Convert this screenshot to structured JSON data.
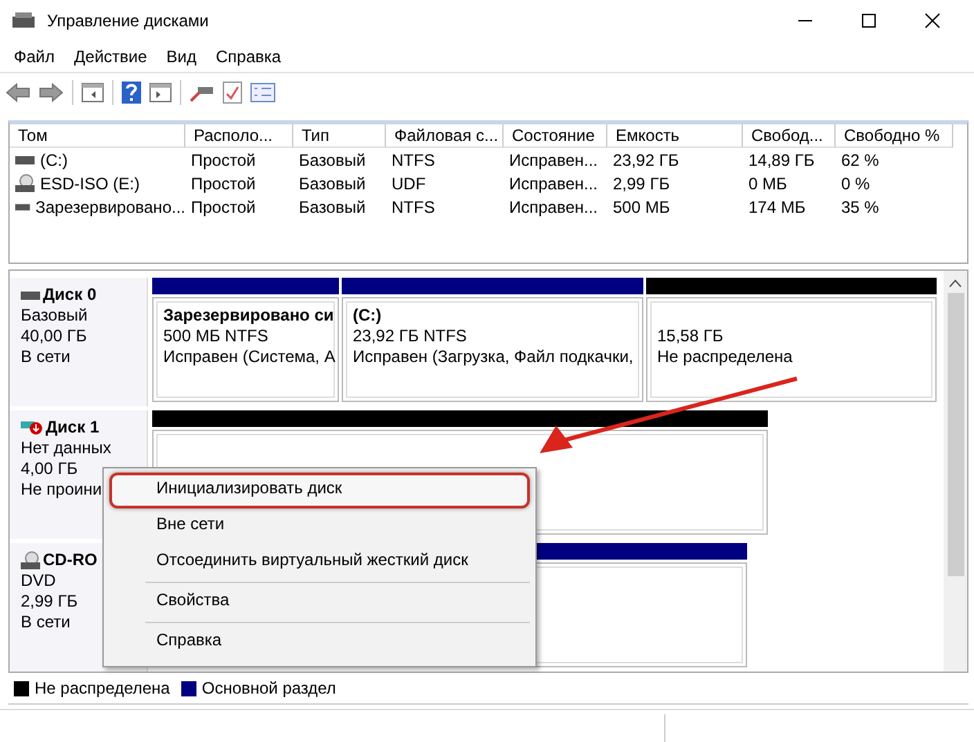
{
  "window": {
    "title": "Управление дисками"
  },
  "menu_bar": [
    "Файл",
    "Действие",
    "Вид",
    "Справка"
  ],
  "table": {
    "columns": [
      "Том",
      "Располо...",
      "Тип",
      "Файловая с...",
      "Состояние",
      "Емкость",
      "Свобод...",
      "Свободно %"
    ],
    "rows": [
      {
        "kind": "drive",
        "cells": [
          "(C:)",
          "Простой",
          "Базовый",
          "NTFS",
          "Исправен...",
          "23,92 ГБ",
          "14,89 ГБ",
          "62 %"
        ]
      },
      {
        "kind": "cd",
        "cells": [
          "ESD-ISO (E:)",
          "Простой",
          "Базовый",
          "UDF",
          "Исправен...",
          "2,99 ГБ",
          "0 МБ",
          "0 %"
        ]
      },
      {
        "kind": "drive",
        "cells": [
          "Зарезервировано...",
          "Простой",
          "Базовый",
          "NTFS",
          "Исправен...",
          "500 МБ",
          "174 МБ",
          "35 %"
        ]
      }
    ]
  },
  "disks": [
    {
      "kind": "basic",
      "name": "Диск 0",
      "lines": [
        "Базовый",
        "40,00 ГБ",
        "В сети"
      ],
      "partitions": [
        {
          "kind": "primary",
          "title": "Зарезервировано си",
          "lines": [
            "500 МБ NTFS",
            "Исправен (Система, А"
          ]
        },
        {
          "kind": "primary",
          "title": "(C:)",
          "lines": [
            "23,92 ГБ NTFS",
            "Исправен (Загрузка, Файл подкачки,"
          ]
        },
        {
          "kind": "unallocated",
          "lines": [
            "15,58 ГБ",
            "Не распределена"
          ]
        }
      ]
    },
    {
      "kind": "uninitialized",
      "name": "Диск 1",
      "lines": [
        "Нет данных",
        "4,00 ГБ",
        "Не проини"
      ],
      "partitions": [
        {
          "kind": "unallocated"
        }
      ]
    },
    {
      "kind": "cdrom",
      "name": "CD-RO",
      "lines": [
        "DVD",
        "2,99 ГБ",
        "В сети"
      ],
      "partitions": [
        {
          "kind": "primary"
        }
      ]
    }
  ],
  "legend": [
    {
      "label": "Не распределена",
      "color": "#000000"
    },
    {
      "label": "Основной раздел",
      "color": "#000080"
    }
  ],
  "context_menu": {
    "groups": [
      [
        {
          "label": "Инициализировать диск",
          "highlighted": true
        },
        {
          "label": "Вне сети",
          "highlighted": false
        },
        {
          "label": "Отсоединить виртуальный жесткий диск",
          "highlighted": false
        }
      ],
      [
        {
          "label": "Свойства",
          "highlighted": false
        }
      ],
      [
        {
          "label": "Справка",
          "highlighted": false
        }
      ]
    ]
  }
}
